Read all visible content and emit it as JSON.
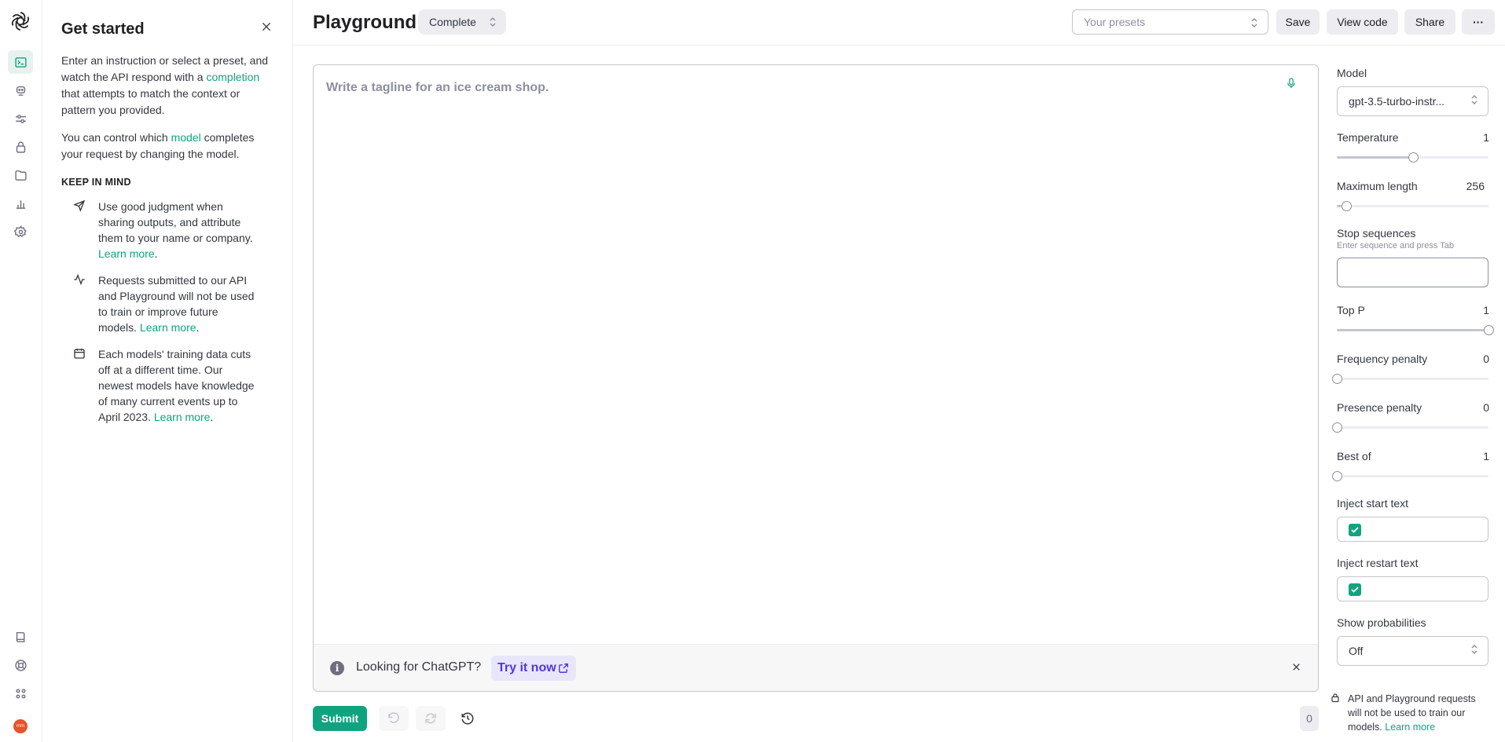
{
  "left_panel": {
    "title": "Get started",
    "intro_before": "Enter an instruction or select a preset, and watch the API respond with a ",
    "intro_link": "completion",
    "intro_after": " that attempts to match the context or pattern you provided.",
    "model_before": "You can control which ",
    "model_link": "model",
    "model_after": " completes your request by changing the model.",
    "keep_in_mind": "KEEP IN MIND",
    "items": [
      {
        "icon": "send-icon",
        "text": "Use good judgment when sharing outputs, and attribute them to your name or company. ",
        "link": "Learn more",
        "after": "."
      },
      {
        "icon": "activity-icon",
        "text": "Requests submitted to our API and Playground will not be used to train or improve future models. ",
        "link": "Learn more",
        "after": "."
      },
      {
        "icon": "calendar-icon",
        "text": "Each models' training data cuts off at a different time. Our newest models have knowledge of many current events up to April 2023. ",
        "link": "Learn more",
        "after": "."
      }
    ]
  },
  "header": {
    "title": "Playground",
    "mode": "Complete",
    "presets_placeholder": "Your presets",
    "save": "Save",
    "view_code": "View code",
    "share": "Share",
    "more": "···"
  },
  "editor": {
    "placeholder": "Write a tagline for an ice cream shop.",
    "banner_text": "Looking for ChatGPT?",
    "banner_link": "Try it now"
  },
  "bottom": {
    "submit": "Submit",
    "token_count": "0"
  },
  "settings": {
    "model_label": "Model",
    "model_value": "gpt-3.5-turbo-instr...",
    "temperature_label": "Temperature",
    "temperature_value": "1",
    "temperature_fraction": 0.5,
    "max_length_label": "Maximum length",
    "max_length_value": "256",
    "max_length_fraction": 0.06,
    "stop_label": "Stop sequences",
    "stop_hint": "Enter sequence and press Tab",
    "top_p_label": "Top P",
    "top_p_value": "1",
    "top_p_fraction": 1.0,
    "freq_label": "Frequency penalty",
    "freq_value": "0",
    "freq_fraction": 0.0,
    "presence_label": "Presence penalty",
    "presence_value": "0",
    "presence_fraction": 0.0,
    "best_of_label": "Best of",
    "best_of_value": "1",
    "best_of_fraction": 0.0,
    "inject_start_label": "Inject start text",
    "inject_start_checked": true,
    "inject_restart_label": "Inject restart text",
    "inject_restart_checked": true,
    "show_prob_label": "Show probabilities",
    "show_prob_value": "Off",
    "note": "API and Playground requests will not be used to train our models. ",
    "note_link": "Learn more"
  },
  "user": {
    "avatar_text": "mm"
  },
  "colors": {
    "accent": "#10a37f",
    "link_purple": "#5436da",
    "avatar": "#e8532c"
  }
}
